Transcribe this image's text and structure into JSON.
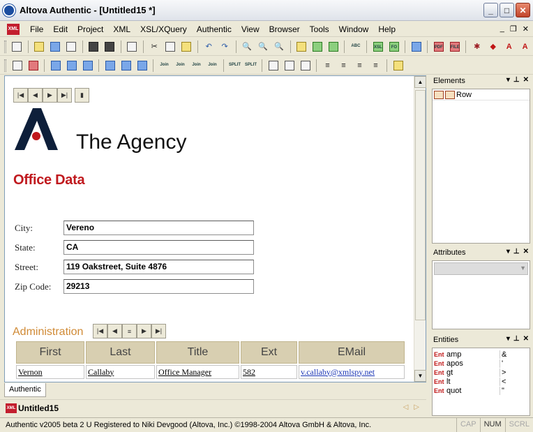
{
  "window": {
    "title": "Altova Authentic - [Untitled15 *]",
    "controls": [
      "_",
      "□",
      "✕"
    ]
  },
  "menu": {
    "items": [
      "File",
      "Edit",
      "Project",
      "XML",
      "XSL/XQuery",
      "Authentic",
      "View",
      "Browser",
      "Tools",
      "Window",
      "Help"
    ],
    "doc_icon": "XML",
    "mdi_controls": [
      "_",
      "❐",
      "✕"
    ]
  },
  "toolbar1": {
    "icons": [
      "new-icon",
      "open-icon",
      "open-url-icon",
      "reload-icon",
      "save-icon",
      "save-all-icon",
      "print-icon",
      "cut-icon",
      "copy-icon",
      "paste-icon",
      "undo-icon",
      "redo-icon",
      "find-icon",
      "find-next-icon",
      "replace-icon",
      "check-wellformed-icon",
      "validate-icon",
      "toggle-icon",
      "spelling-icon",
      "xsl-transform-icon",
      "xslfo-transform-icon",
      "browser-view-icon",
      "pdf-icon",
      "file-icon",
      "debug-icon",
      "marker-icon",
      "text-a-icon",
      "text-a2-icon"
    ],
    "labels": {
      "xsl": "XSL",
      "fo": "FO",
      "pdf": "PDF",
      "file": "FILE",
      "abc": "ABC"
    }
  },
  "toolbar2": {
    "join_label": "Join",
    "split_label": "SPLIT"
  },
  "document": {
    "company_name": "The Agency",
    "section_title": "Office Data",
    "fields": [
      {
        "label": "City:",
        "value": "Vereno"
      },
      {
        "label": "State:",
        "value": "CA"
      },
      {
        "label": "Street:",
        "value": "119 Oakstreet, Suite 4876"
      },
      {
        "label": "Zip Code:",
        "value": "29213"
      }
    ],
    "admin_heading": "Administration",
    "table": {
      "headers": [
        "First",
        "Last",
        "Title",
        "Ext",
        "EMail"
      ],
      "rows": [
        [
          "Vernon",
          "Callaby",
          "Office Manager",
          "582",
          "v.callaby@xmlspy.net"
        ]
      ]
    }
  },
  "view_tab": "Authentic",
  "doc_tab": "Untitled15",
  "panels": {
    "elements": {
      "title": "Elements",
      "items": [
        "Row"
      ]
    },
    "attributes": {
      "title": "Attributes"
    },
    "entities": {
      "title": "Entities",
      "tag": "Ent",
      "items": [
        {
          "name": "amp",
          "value": "&"
        },
        {
          "name": "apos",
          "value": "'"
        },
        {
          "name": "gt",
          "value": ">"
        },
        {
          "name": "lt",
          "value": "<"
        },
        {
          "name": "quot",
          "value": "\""
        }
      ]
    },
    "controls": [
      "▾",
      "⊥",
      "✕"
    ]
  },
  "status": {
    "text": "Authentic v2005 beta 2 U   Registered to Niki Devgood (Altova, Inc.)   ©1998-2004 Altova GmbH & Altova, Inc.",
    "indicators": [
      {
        "label": "CAP",
        "on": false
      },
      {
        "label": "NUM",
        "on": true
      },
      {
        "label": "SCRL",
        "on": false
      }
    ]
  },
  "colors": {
    "heading_red": "#c0191e",
    "admin_orange": "#d08a35",
    "table_header": "#d8cfb1",
    "link_blue": "#1a35b5"
  }
}
